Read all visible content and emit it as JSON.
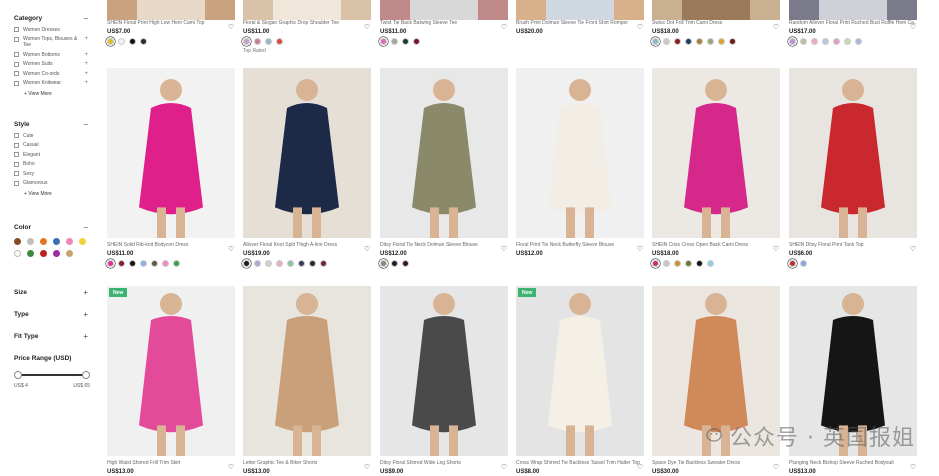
{
  "filters": {
    "category": {
      "title": "Category",
      "items": [
        "Women Dresses",
        "Women Tops, Blouses & Tee",
        "Women Bottoms",
        "Women Suits",
        "Women Co-ords",
        "Women Knitwear"
      ],
      "view_more": "+ View More"
    },
    "style": {
      "title": "Style",
      "items": [
        "Cute",
        "Casual",
        "Elegant",
        "Boho",
        "Sexy",
        "Glamorous"
      ],
      "view_more": "+ View More"
    },
    "color": {
      "title": "Color",
      "swatches": [
        "#8b4a24",
        "#bfbfbf",
        "#e0782a",
        "#3a6fb5",
        "#e98ab8",
        "#f2d23b",
        "#ffffff",
        "#3f8a3c",
        "#c01f1f",
        "#9c2aa0",
        "#c9a46a"
      ]
    },
    "size": {
      "title": "Size"
    },
    "type": {
      "title": "Type"
    },
    "fit_type": {
      "title": "Fit Type"
    },
    "price": {
      "title": "Price Range (USD)",
      "min": "US$ 4",
      "max": "US$ 65"
    }
  },
  "top_row": [
    {
      "title": "SHEIN Floral Print High Low Hem Cami Top",
      "price": "US$7.00",
      "swatches": [
        "#e0c020",
        "#f2f2f2",
        "#111111",
        "#2a2a2a"
      ]
    },
    {
      "title": "Floral & Slogan Graphic Drop Shoulder Tee",
      "price": "US$11.00",
      "swatches": [
        "#c8a0c8",
        "#c87f95",
        "#9db6c7",
        "#d94a3a"
      ],
      "extra": "Top Rated"
    },
    {
      "title": "Twist Tie Back Batwing Sleeve Tee",
      "price": "US$11.00",
      "swatches": [
        "#e36bb5",
        "#a5a5a5",
        "#1e3a2a",
        "#7a1030"
      ]
    },
    {
      "title": "Brush Print Dolman Sleeve Tie Front Shirt Romper",
      "price": "US$20.00",
      "swatches": []
    },
    {
      "title": "Swiss Dot Frill Trim Cami Dress",
      "price": "US$18.00",
      "swatches": [
        "#8bb8c9",
        "#c9c9c9",
        "#8c1d1d",
        "#1d3b6b",
        "#b07a3a",
        "#9ba573",
        "#e0a030",
        "#6b1c1c"
      ]
    },
    {
      "title": "Random Allover Floral Print Ruched Bust Ruffle Hem Ca...",
      "price": "US$17.00",
      "swatches": [
        "#b494d4",
        "#bfbfaa",
        "#f0a8c8",
        "#b5c8e0",
        "#e0a0c0",
        "#c8d8b0",
        "#a8b8e8"
      ]
    }
  ],
  "mid_row": [
    {
      "title": "SHEIN Solid Rib-knit Bodycon Dress",
      "price": "US$11.00",
      "swatches": [
        "#e0338f",
        "#8a1a2a",
        "#111111",
        "#8fb0e8",
        "#5a5a4a",
        "#f28ac0",
        "#3aa04a"
      ]
    },
    {
      "title": "Allover Floral Knot Split Thigh A-line Dress",
      "price": "US$19.00",
      "swatches": [
        "#1c1c1c",
        "#b0a8d0",
        "#d0d0d0",
        "#e8b0b8",
        "#8fc0a8",
        "#3a3a5a",
        "#2a2a2a",
        "#6a2a3a"
      ]
    },
    {
      "title": "Ditsy Floral Tie Neck Dolman Sleeve Blouse",
      "price": "US$12.00",
      "swatches": [
        "#8a8a7a",
        "#1a2030",
        "#3a1520"
      ]
    },
    {
      "title": "Floral Print Tie Neck Butterfly Sleeve Blouse",
      "price": "US$12.00",
      "swatches": []
    },
    {
      "title": "SHEIN Criss Cross Open Back Cami Dress",
      "price": "US$18.00",
      "swatches": [
        "#cf2a7a",
        "#c8c8c8",
        "#c89030",
        "#6a7a30",
        "#111111",
        "#8fd0e0"
      ]
    },
    {
      "title": "SHEIN Ditsy Floral Print Tank Top",
      "price": "US$6.00",
      "swatches": [
        "#c03030",
        "#8aa8e0"
      ]
    }
  ],
  "bottom_row": [
    {
      "title": "High Waist Shirred Frill Trim Skirt",
      "price": "US$13.00",
      "badge": "New"
    },
    {
      "title": "Letter Graphic Tee & Biker Shorts",
      "price": "US$13.00"
    },
    {
      "title": "Ditsy Floral Shirred Wide Leg Shorts",
      "price": "US$9.00"
    },
    {
      "title": "Cross Wrap Shirred Tie Backless Tassel Trim Halter Top",
      "price": "US$8.00",
      "badge": "New"
    },
    {
      "title": "Space Dye Tie Backless Sweater Dress",
      "price": "US$30.00"
    },
    {
      "title": "Plunging Neck Bishop Sleeve Ruched Bodysuit",
      "price": "US$13.00"
    }
  ],
  "icons": {
    "wishlist": "heart-icon",
    "collapse": "minus-icon",
    "expand": "plus-icon"
  },
  "watermark": {
    "text": "公众号 · 英国报姐"
  }
}
